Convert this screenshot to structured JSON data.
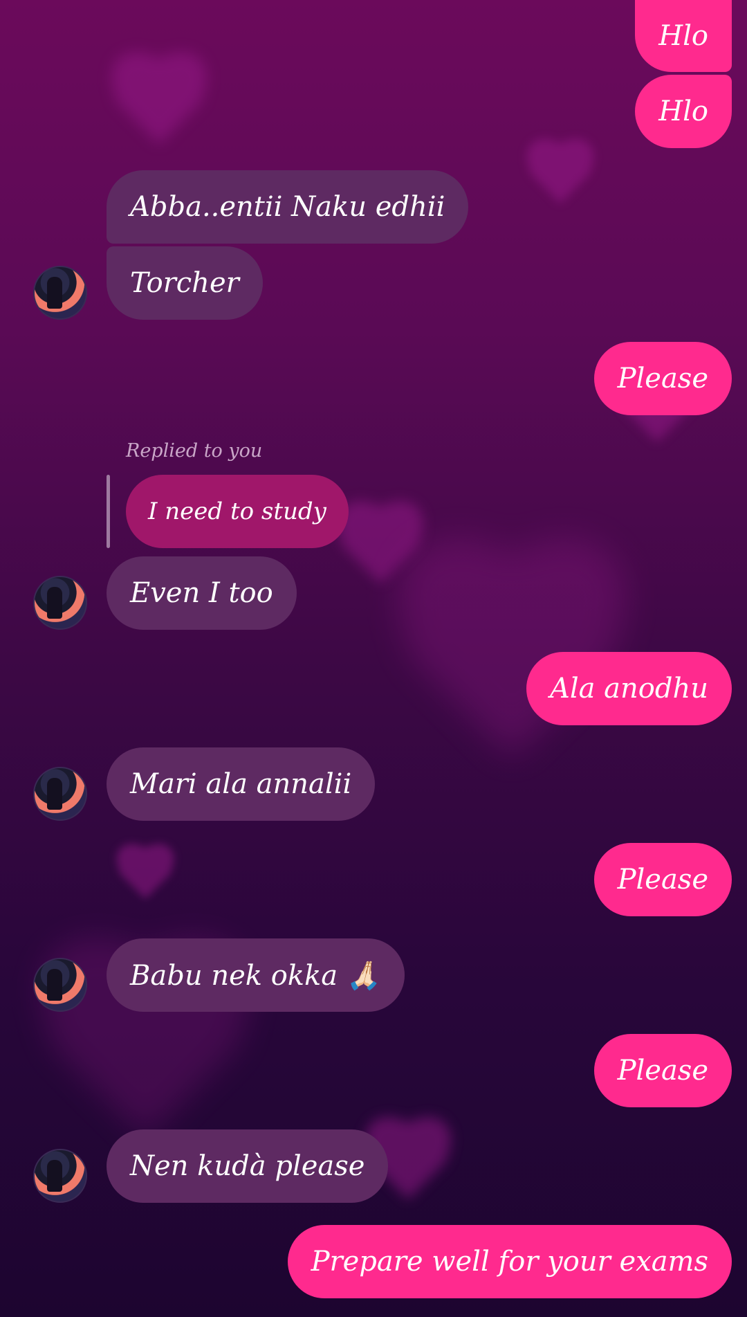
{
  "chat": {
    "messages": [
      {
        "side": "sent",
        "text": "Hlo"
      },
      {
        "side": "sent",
        "text": "Hlo"
      },
      {
        "side": "received",
        "text": "Abba..entii Naku edhii"
      },
      {
        "side": "received",
        "text": "Torcher"
      },
      {
        "side": "sent",
        "text": "Please"
      },
      {
        "side": "received",
        "text": "Even I too"
      },
      {
        "side": "sent",
        "text": "Ala anodhu"
      },
      {
        "side": "received",
        "text": "Mari ala annalii"
      },
      {
        "side": "sent",
        "text": "Please"
      },
      {
        "side": "received",
        "text": "Babu nek okka 🙏🏻"
      },
      {
        "side": "sent",
        "text": "Please"
      },
      {
        "side": "received",
        "text": "Nen kudà please"
      },
      {
        "side": "sent",
        "text": "Prepare well for your exams"
      }
    ],
    "reply": {
      "label": "Replied to you",
      "quoted_text": "I need to study"
    }
  },
  "colors": {
    "sent_bubble": "#ff2a8e",
    "received_bubble": "#5e2a62",
    "reply_bubble": "#a0176a",
    "background_top": "#6b0a5b",
    "background_bottom": "#1d0530"
  },
  "icons": {
    "avatar": "contact-avatar-icon"
  }
}
